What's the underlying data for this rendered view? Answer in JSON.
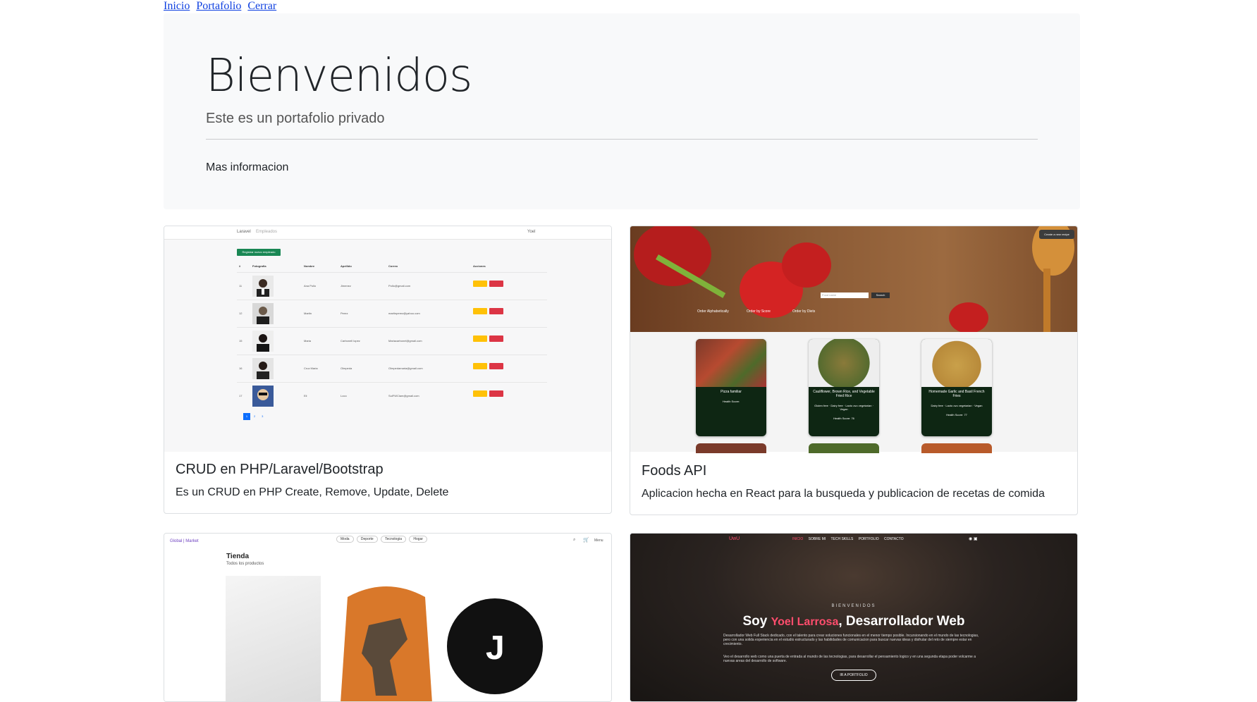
{
  "nav": {
    "links": [
      "Inicio",
      "Portafolio",
      "Cerrar"
    ]
  },
  "jumbotron": {
    "title": "Bienvenidos",
    "lead": "Este es un portafolio privado",
    "more": "Mas informacion"
  },
  "cards": [
    {
      "title": "CRUD en PHP/Laravel/Bootstrap",
      "description": "Es un CRUD en PHP Create, Remove, Update, Delete",
      "preview": {
        "brand": "Laravel",
        "nav_item": "Empleados",
        "user_menu": "Yoel",
        "register_button": "Registrar nuevo empleado",
        "columns": [
          "#",
          "Fotografia",
          "Nombre",
          "Apellido",
          "Correo",
          "Acciones"
        ],
        "rows": [
          [
            "11",
            "Ana Pollo",
            "Jimenez",
            "Pollo@gmail.com"
          ],
          [
            "12",
            "Martin",
            "Perez",
            "martinperez@yahoo.com"
          ],
          [
            "15",
            "Maria",
            "Carbonell lopez",
            "Mariacarbonel@gmail.com"
          ],
          [
            "16",
            "Cruz Maria",
            "Olmpeda",
            "Olmpedamaria@gmail.com"
          ],
          [
            "17",
            "Eli",
            "Loco",
            "SuiFWClam@gmail.com"
          ]
        ],
        "edit_label": "Editar",
        "delete_label": "Borrar",
        "pages": [
          "1",
          "2",
          "3"
        ]
      }
    },
    {
      "title": "Foods API",
      "description": "Aplicacion hecha en React para la busqueda y publicacion de recetas de comida",
      "preview": {
        "create_button": "Create a new recipe",
        "search_placeholder": "Food name",
        "search_button": "Search",
        "filters": [
          "Order Alphabetically",
          "Order by Score",
          "Order by Diets"
        ],
        "recipes": [
          {
            "name": "Pizza familiar",
            "diets": "",
            "score": "Health Score:"
          },
          {
            "name": "Cauliflower, Brown Rice, and Vegetable Fried Rice",
            "diets": "Gluten free · Dairy free · Lacto ovo vegetarian · Vegan",
            "score": "Health Score: 76"
          },
          {
            "name": "Homemade Garlic and Basil French Fries",
            "diets": "Dairy free · Lacto ovo vegetarian · Vegan",
            "score": "Health Score: 77"
          }
        ]
      }
    },
    {
      "title": "",
      "description": "",
      "preview": {
        "brand": "Global | Market",
        "menus": [
          "Moda",
          "Deporte",
          "Tecnologia",
          "Hogar"
        ],
        "menu_right": "Menu",
        "heading": "Tienda",
        "subheading": "Todos los productos"
      }
    },
    {
      "title": "",
      "description": "",
      "preview": {
        "brand": "UwU",
        "menus": [
          "INICIO",
          "SOBRE MI",
          "TECH SKILLS",
          "PORTFOLIO",
          "CONTACTO"
        ],
        "kicker": "BIENVENIDOS",
        "headline_pre": "Soy ",
        "headline_name": "Yoel Larrosa",
        "headline_post": ", Desarrollador Web",
        "paragraph1": "Desarrollador Web Full Stack dedicado, con el talento para crear soluciones funcionales en el menor tiempo posible. Incursionando en el mundo de las tecnologias, pero con una solida experiencia en el estudio estructurado y las habilidades de comunicacion para buscar nuevas ideas y disfrutar del reto de siempre estar en crecimiento.",
        "paragraph2": "Veo el desarrollo web como una puerta de entrada al mundo de las tecnologias, para desarrollar el pensamiento logico y en una segunda etapa poder volcarme a nuevas areas del desarrollo de software.",
        "cta": "IR A PORTFOLIO"
      }
    }
  ]
}
